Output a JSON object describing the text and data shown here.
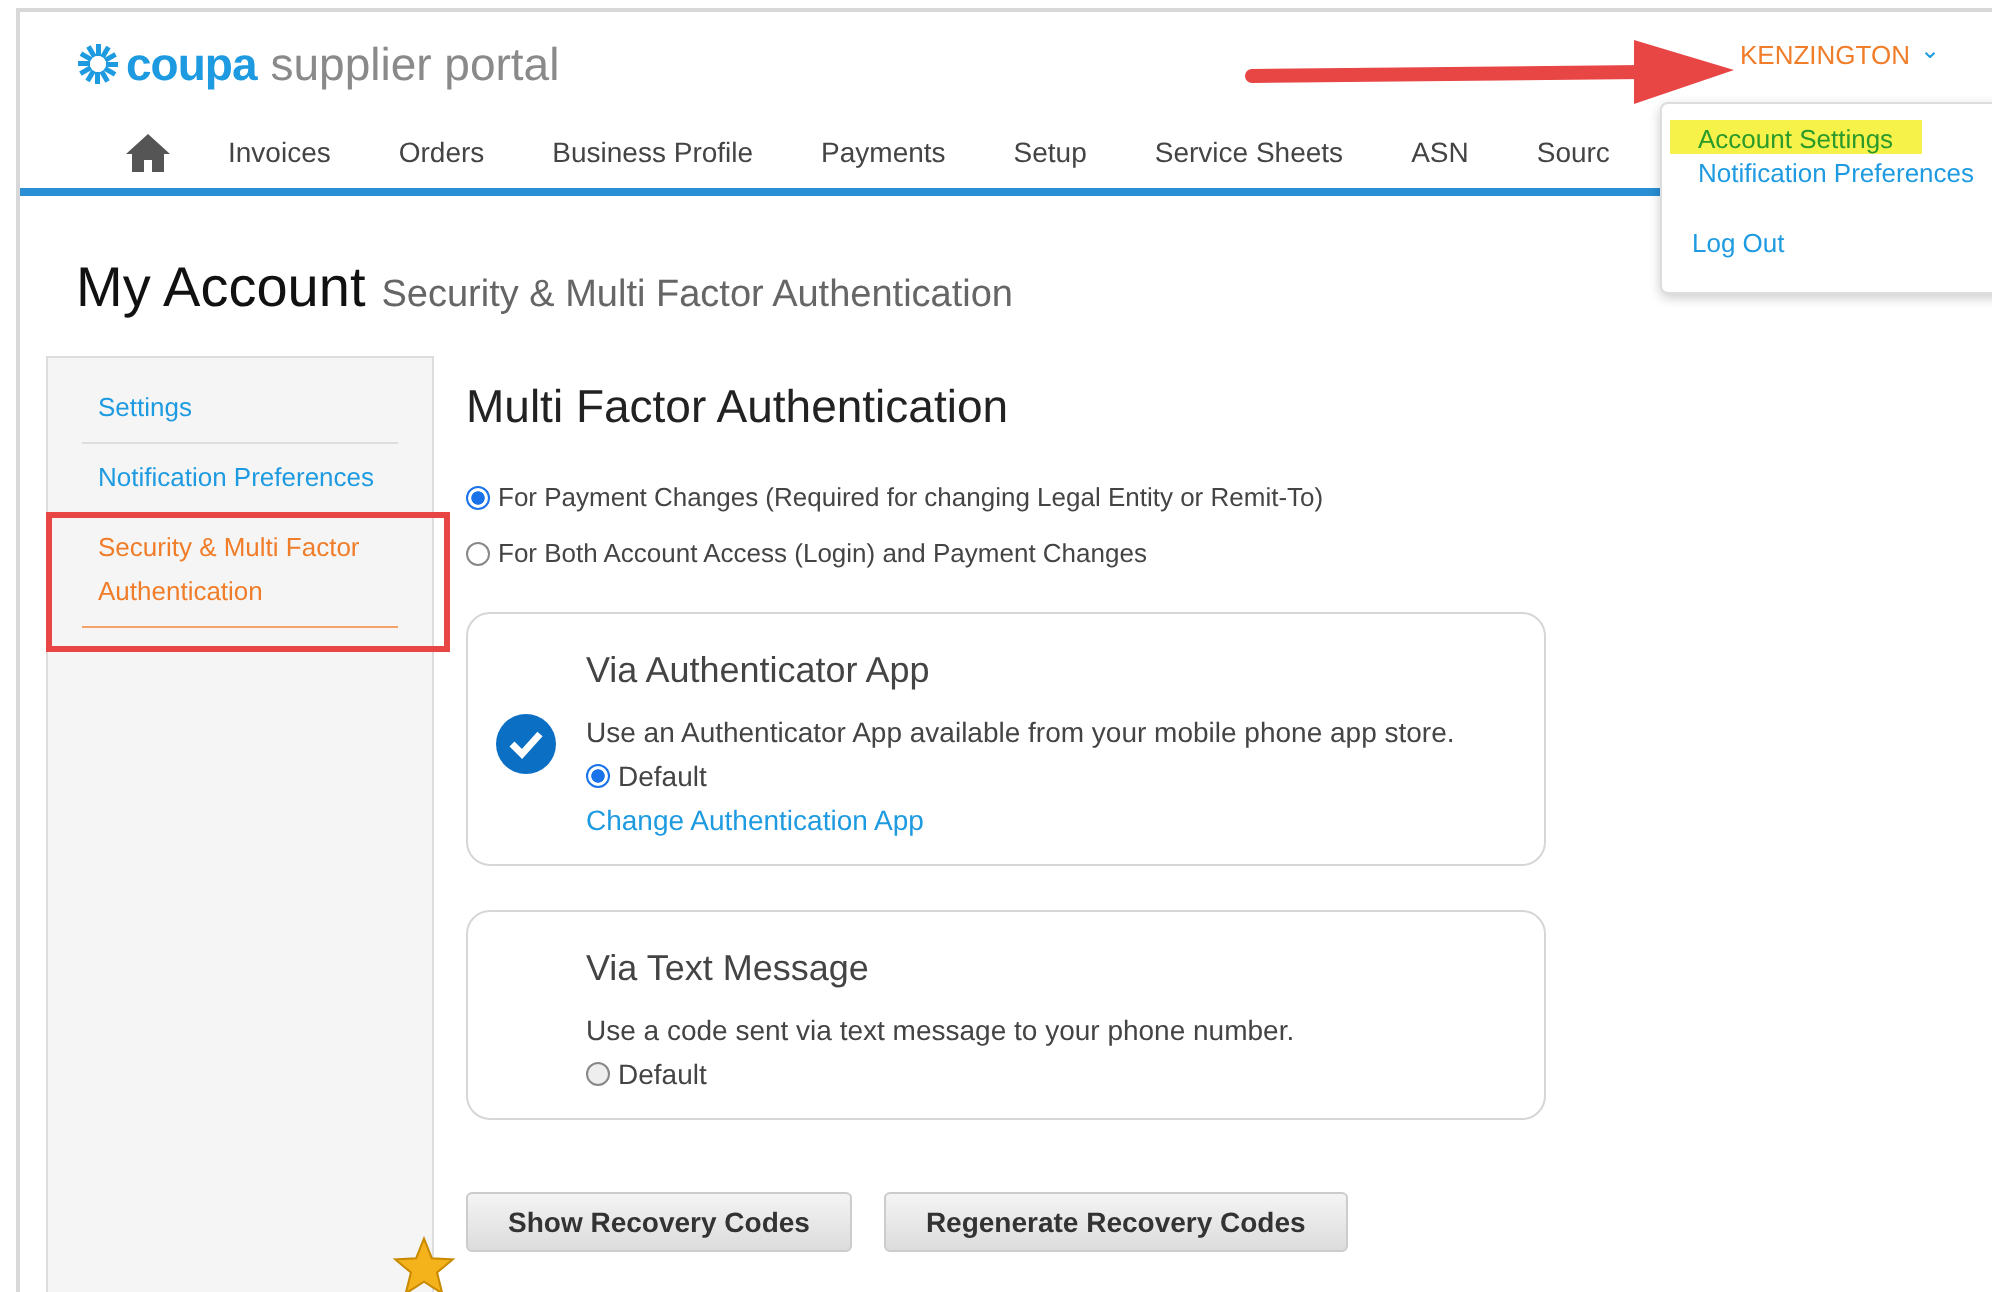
{
  "header": {
    "logo_brand": "coupa",
    "logo_product": "supplier portal",
    "user": "KENZINGTON",
    "caret": "⌄"
  },
  "nav": [
    {
      "label": "Invoices"
    },
    {
      "label": "Orders"
    },
    {
      "label": "Business Profile"
    },
    {
      "label": "Payments"
    },
    {
      "label": "Setup"
    },
    {
      "label": "Service Sheets"
    },
    {
      "label": "ASN"
    },
    {
      "label": "Sourc"
    }
  ],
  "user_menu": {
    "items": [
      {
        "label": "Account Settings",
        "selected": true
      },
      {
        "label": "Notification Preferences",
        "selected": false
      }
    ],
    "logout": "Log Out"
  },
  "page": {
    "title": "My Account",
    "subtitle": "Security & Multi Factor Authentication"
  },
  "sidebar": {
    "items": [
      {
        "label": "Settings",
        "selected": false
      },
      {
        "label": "Notification Preferences",
        "selected": false
      },
      {
        "label": "Security & Multi Factor Authentication",
        "selected": true
      }
    ]
  },
  "main": {
    "heading": "Multi Factor Authentication",
    "scope": [
      {
        "label": "For Payment Changes (Required for changing Legal Entity or Remit-To)",
        "selected": true
      },
      {
        "label": "For Both Account Access (Login) and Payment Changes",
        "selected": false
      }
    ],
    "methods": [
      {
        "title": "Via Authenticator App",
        "description": "Use an Authenticator App available from your mobile phone app store.",
        "default_label": "Default",
        "default": true,
        "active": true,
        "link": "Change Authentication App"
      },
      {
        "title": "Via Text Message",
        "description": "Use a code sent via text message to your phone number.",
        "default_label": "Default",
        "default": false,
        "active": false
      }
    ],
    "buttons": [
      "Show Recovery Codes",
      "Regenerate Recovery Codes"
    ]
  }
}
